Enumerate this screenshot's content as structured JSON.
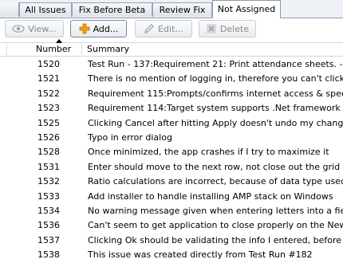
{
  "tabs": [
    {
      "label": "All Issues"
    },
    {
      "label": "Fix Before Beta"
    },
    {
      "label": "Review Fix"
    },
    {
      "label": "Not Assigned"
    }
  ],
  "toolbar": {
    "view_label": "View...",
    "add_label": "Add...",
    "edit_label": "Edit...",
    "delete_label": "Delete"
  },
  "columns": {
    "number": "Number",
    "summary": "Summary"
  },
  "rows": [
    {
      "number": "1520",
      "summary": "Test Run - 137:Requirement 21: Print attendance sheets. -"
    },
    {
      "number": "1521",
      "summary": "There is no mention of logging in, therefore you can't click o"
    },
    {
      "number": "1522",
      "summary": "Requirement 115:Prompts/confirms internet access & speed"
    },
    {
      "number": "1523",
      "summary": "Requirement 114:Target system supports .Net framework"
    },
    {
      "number": "1525",
      "summary": "Clicking Cancel after hitting Apply doesn't undo my changes"
    },
    {
      "number": "1526",
      "summary": "Typo in error dialog"
    },
    {
      "number": "1528",
      "summary": "Once minimized, the app crashes if I try to maximize it"
    },
    {
      "number": "1531",
      "summary": "Enter should move to the next row, not close out the grid"
    },
    {
      "number": "1532",
      "summary": "Ratio calculations are incorrect, because of data type used"
    },
    {
      "number": "1533",
      "summary": "Add installer to handle installing AMP stack on Windows"
    },
    {
      "number": "1534",
      "summary": "No warning message given when entering letters into a field"
    },
    {
      "number": "1536",
      "summary": "Can't seem to get application to close properly on the New M"
    },
    {
      "number": "1537",
      "summary": "Clicking Ok should be validating the info I entered, before sa"
    },
    {
      "number": "1538",
      "summary": "This issue was created directly from Test Run #182"
    }
  ],
  "icons": {
    "view": "eye-icon",
    "add": "plus-icon",
    "edit": "pencil-icon",
    "delete": "delete-x-icon"
  },
  "colors": {
    "add_icon": "#f0a020",
    "delete_icon": "#c62020"
  }
}
